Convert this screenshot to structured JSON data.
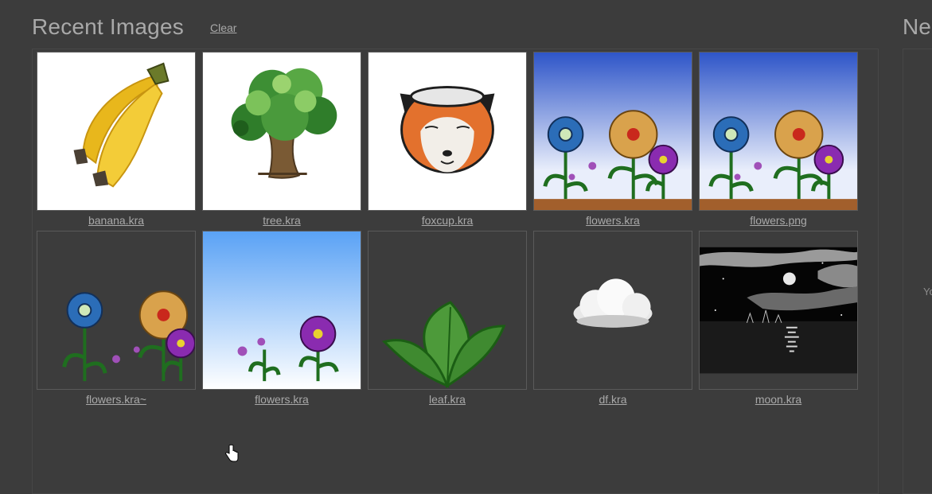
{
  "header": {
    "title": "Recent Images",
    "clear_label": "Clear",
    "right_title": "Ne",
    "right_snippet": "Yo"
  },
  "colors": {
    "background": "#3c3c3c",
    "text": "#a9a9a9",
    "panel_border": "#474747"
  },
  "recent_images": [
    {
      "filename": "banana.kra",
      "preview": "banana"
    },
    {
      "filename": "tree.kra",
      "preview": "tree"
    },
    {
      "filename": "foxcup.kra",
      "preview": "fox-cup"
    },
    {
      "filename": "flowers.kra",
      "preview": "flowers-ground"
    },
    {
      "filename": "flowers.png",
      "preview": "flowers-ground"
    },
    {
      "filename": "flowers.kra~",
      "preview": "flowers-transparent"
    },
    {
      "filename": "flowers.kra",
      "preview": "flowers-sky"
    },
    {
      "filename": "leaf.kra",
      "preview": "leaf"
    },
    {
      "filename": "df.kra",
      "preview": "cloud"
    },
    {
      "filename": "moon.kra",
      "preview": "moon-night"
    }
  ]
}
